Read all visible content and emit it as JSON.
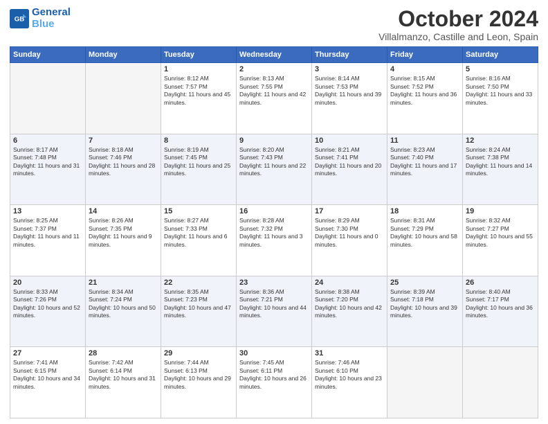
{
  "header": {
    "logo_line1": "General",
    "logo_line2": "Blue",
    "month": "October 2024",
    "location": "Villalmanzo, Castille and Leon, Spain"
  },
  "weekdays": [
    "Sunday",
    "Monday",
    "Tuesday",
    "Wednesday",
    "Thursday",
    "Friday",
    "Saturday"
  ],
  "rows": [
    [
      {
        "day": "",
        "info": ""
      },
      {
        "day": "",
        "info": ""
      },
      {
        "day": "1",
        "info": "Sunrise: 8:12 AM\nSunset: 7:57 PM\nDaylight: 11 hours and 45 minutes."
      },
      {
        "day": "2",
        "info": "Sunrise: 8:13 AM\nSunset: 7:55 PM\nDaylight: 11 hours and 42 minutes."
      },
      {
        "day": "3",
        "info": "Sunrise: 8:14 AM\nSunset: 7:53 PM\nDaylight: 11 hours and 39 minutes."
      },
      {
        "day": "4",
        "info": "Sunrise: 8:15 AM\nSunset: 7:52 PM\nDaylight: 11 hours and 36 minutes."
      },
      {
        "day": "5",
        "info": "Sunrise: 8:16 AM\nSunset: 7:50 PM\nDaylight: 11 hours and 33 minutes."
      }
    ],
    [
      {
        "day": "6",
        "info": "Sunrise: 8:17 AM\nSunset: 7:48 PM\nDaylight: 11 hours and 31 minutes."
      },
      {
        "day": "7",
        "info": "Sunrise: 8:18 AM\nSunset: 7:46 PM\nDaylight: 11 hours and 28 minutes."
      },
      {
        "day": "8",
        "info": "Sunrise: 8:19 AM\nSunset: 7:45 PM\nDaylight: 11 hours and 25 minutes."
      },
      {
        "day": "9",
        "info": "Sunrise: 8:20 AM\nSunset: 7:43 PM\nDaylight: 11 hours and 22 minutes."
      },
      {
        "day": "10",
        "info": "Sunrise: 8:21 AM\nSunset: 7:41 PM\nDaylight: 11 hours and 20 minutes."
      },
      {
        "day": "11",
        "info": "Sunrise: 8:23 AM\nSunset: 7:40 PM\nDaylight: 11 hours and 17 minutes."
      },
      {
        "day": "12",
        "info": "Sunrise: 8:24 AM\nSunset: 7:38 PM\nDaylight: 11 hours and 14 minutes."
      }
    ],
    [
      {
        "day": "13",
        "info": "Sunrise: 8:25 AM\nSunset: 7:37 PM\nDaylight: 11 hours and 11 minutes."
      },
      {
        "day": "14",
        "info": "Sunrise: 8:26 AM\nSunset: 7:35 PM\nDaylight: 11 hours and 9 minutes."
      },
      {
        "day": "15",
        "info": "Sunrise: 8:27 AM\nSunset: 7:33 PM\nDaylight: 11 hours and 6 minutes."
      },
      {
        "day": "16",
        "info": "Sunrise: 8:28 AM\nSunset: 7:32 PM\nDaylight: 11 hours and 3 minutes."
      },
      {
        "day": "17",
        "info": "Sunrise: 8:29 AM\nSunset: 7:30 PM\nDaylight: 11 hours and 0 minutes."
      },
      {
        "day": "18",
        "info": "Sunrise: 8:31 AM\nSunset: 7:29 PM\nDaylight: 10 hours and 58 minutes."
      },
      {
        "day": "19",
        "info": "Sunrise: 8:32 AM\nSunset: 7:27 PM\nDaylight: 10 hours and 55 minutes."
      }
    ],
    [
      {
        "day": "20",
        "info": "Sunrise: 8:33 AM\nSunset: 7:26 PM\nDaylight: 10 hours and 52 minutes."
      },
      {
        "day": "21",
        "info": "Sunrise: 8:34 AM\nSunset: 7:24 PM\nDaylight: 10 hours and 50 minutes."
      },
      {
        "day": "22",
        "info": "Sunrise: 8:35 AM\nSunset: 7:23 PM\nDaylight: 10 hours and 47 minutes."
      },
      {
        "day": "23",
        "info": "Sunrise: 8:36 AM\nSunset: 7:21 PM\nDaylight: 10 hours and 44 minutes."
      },
      {
        "day": "24",
        "info": "Sunrise: 8:38 AM\nSunset: 7:20 PM\nDaylight: 10 hours and 42 minutes."
      },
      {
        "day": "25",
        "info": "Sunrise: 8:39 AM\nSunset: 7:18 PM\nDaylight: 10 hours and 39 minutes."
      },
      {
        "day": "26",
        "info": "Sunrise: 8:40 AM\nSunset: 7:17 PM\nDaylight: 10 hours and 36 minutes."
      }
    ],
    [
      {
        "day": "27",
        "info": "Sunrise: 7:41 AM\nSunset: 6:15 PM\nDaylight: 10 hours and 34 minutes."
      },
      {
        "day": "28",
        "info": "Sunrise: 7:42 AM\nSunset: 6:14 PM\nDaylight: 10 hours and 31 minutes."
      },
      {
        "day": "29",
        "info": "Sunrise: 7:44 AM\nSunset: 6:13 PM\nDaylight: 10 hours and 29 minutes."
      },
      {
        "day": "30",
        "info": "Sunrise: 7:45 AM\nSunset: 6:11 PM\nDaylight: 10 hours and 26 minutes."
      },
      {
        "day": "31",
        "info": "Sunrise: 7:46 AM\nSunset: 6:10 PM\nDaylight: 10 hours and 23 minutes."
      },
      {
        "day": "",
        "info": ""
      },
      {
        "day": "",
        "info": ""
      }
    ]
  ]
}
